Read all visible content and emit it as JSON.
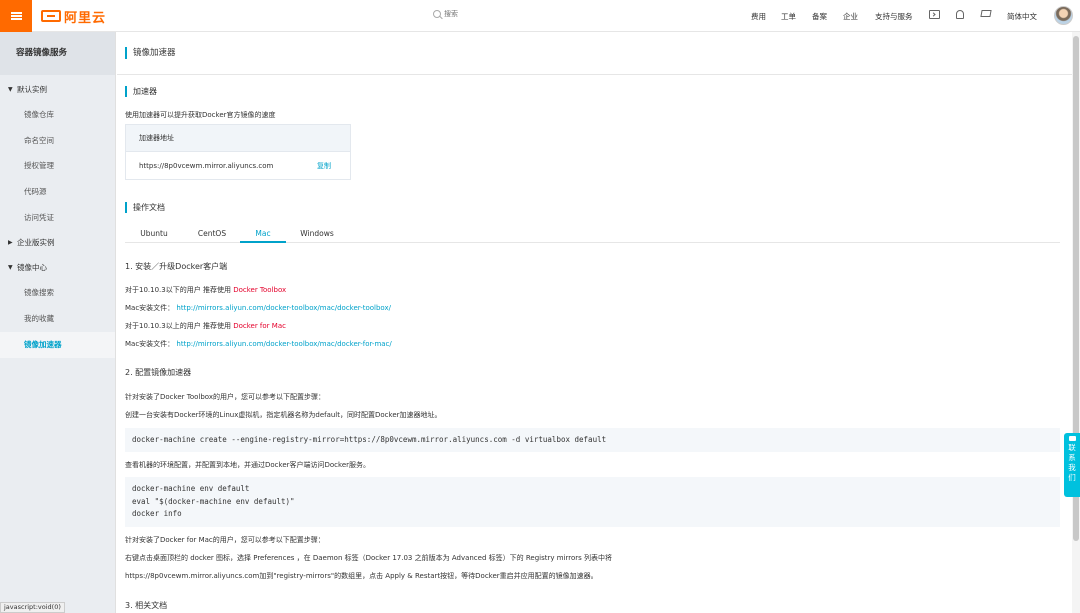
{
  "topbar": {
    "logo_text": "阿里云",
    "search_placeholder": "搜索",
    "nav": [
      "费用",
      "工单",
      "备案",
      "企业",
      "支持与服务"
    ],
    "language": "简体中文"
  },
  "sidebar": {
    "title": "容器镜像服务",
    "groups": [
      {
        "label": "默认实例",
        "expanded": true
      },
      {
        "label": "企业版实例",
        "expanded": false
      },
      {
        "label": "镜像中心",
        "expanded": true
      }
    ],
    "default_items": [
      "镜像仓库",
      "命名空间",
      "授权管理",
      "代码源",
      "访问凭证"
    ],
    "center_items": [
      "镜像搜索",
      "我的收藏",
      "镜像加速器"
    ],
    "active_item": "镜像加速器"
  },
  "page": {
    "title": "镜像加速器",
    "accelerator": {
      "section_title": "加速器",
      "description": "使用加速器可以提升获取Docker官方镜像的速度",
      "table_header": "加速器地址",
      "address": "https://8p0vcewm.mirror.aliyuncs.com",
      "copy_label": "复制"
    },
    "docs": {
      "section_title": "操作文档",
      "tabs": [
        "Ubuntu",
        "CentOS",
        "Mac",
        "Windows"
      ],
      "active_tab": "Mac",
      "step1": {
        "heading": "1. 安装／升级Docker客户端",
        "line1_prefix": "对于10.10.3以下的用户 推荐使用",
        "line1_link": "Docker Toolbox",
        "line2_prefix": "Mac安装文件：",
        "line2_link": "http://mirrors.aliyun.com/docker-toolbox/mac/docker-toolbox/",
        "line3_prefix": "对于10.10.3以上的用户 推荐使用",
        "line3_link": "Docker for Mac",
        "line4_prefix": "Mac安装文件：",
        "line4_link": "http://mirrors.aliyun.com/docker-toolbox/mac/docker-for-mac/"
      },
      "step2": {
        "heading": "2. 配置镜像加速器",
        "text1": "针对安装了Docker Toolbox的用户，您可以参考以下配置步骤：",
        "text2": "创建一台安装有Docker环境的Linux虚拟机，指定机器名称为default，同时配置Docker加速器地址。",
        "code1": "docker-machine create --engine-registry-mirror=https://8p0vcewm.mirror.aliyuncs.com -d virtualbox default",
        "text3": "查看机器的环境配置，并配置到本地，并通过Docker客户端访问Docker服务。",
        "code2": [
          "docker-machine env default",
          "eval \"$(docker-machine env default)\"",
          "docker info"
        ],
        "text4": "针对安装了Docker for Mac的用户，您可以参考以下配置步骤：",
        "text5": "右键点击桌面顶栏的 docker 图标，选择 Preferences ，在 Daemon 标签（Docker 17.03 之前版本为 Advanced 标签）下的 Registry mirrors 列表中将",
        "text6": "https://8p0vcewm.mirror.aliyuncs.com加到\"registry-mirrors\"的数组里，点击 Apply & Restart按钮，等待Docker重启并应用配置的镜像加速器。"
      },
      "step3": {
        "heading": "3. 相关文档"
      }
    }
  },
  "contact": {
    "chars": [
      "联",
      "系",
      "我",
      "们"
    ]
  },
  "statusbar": "javascript:void(0)",
  "colors": {
    "brand": "#ff6a00",
    "accent": "#00a2ca",
    "highlight": "#e4002b",
    "contact": "#00c1de"
  }
}
